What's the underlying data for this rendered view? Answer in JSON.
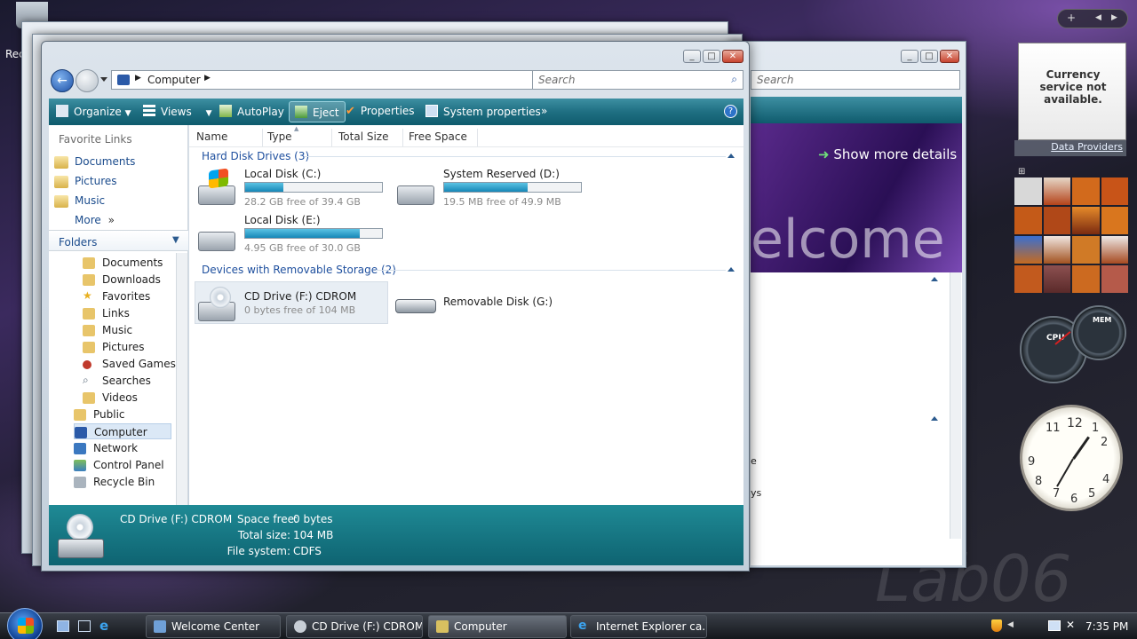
{
  "desktop": {
    "recycle_label": "Rec",
    "watermark": "Lab06"
  },
  "main_window": {
    "address": {
      "root": "Computer"
    },
    "search_placeholder": "Search",
    "toolbar": {
      "organize": "Organize",
      "views": "Views",
      "autoplay": "AutoPlay",
      "eject": "Eject",
      "properties": "Properties",
      "system_properties": "System properties",
      "more": "»"
    },
    "favorites": {
      "title": "Favorite Links",
      "items": [
        "Documents",
        "Pictures",
        "Music"
      ],
      "more": "More"
    },
    "folders": {
      "title": "Folders",
      "items": [
        "Documents",
        "Downloads",
        "Favorites",
        "Links",
        "Music",
        "Pictures",
        "Saved Games",
        "Searches",
        "Videos",
        "Public",
        "Computer",
        "Network",
        "Control Panel",
        "Recycle Bin"
      ]
    },
    "columns": [
      "Name",
      "Type",
      "Total Size",
      "Free Space"
    ],
    "groups": {
      "hdd_title": "Hard Disk Drives (3)",
      "removable_title": "Devices with Removable Storage (2)"
    },
    "drives": {
      "c": {
        "name": "Local Disk (C:)",
        "free": "28.2 GB free of 39.4 GB",
        "used_fraction": 0.28
      },
      "d": {
        "name": "System Reserved (D:)",
        "free": "19.5 MB free of 49.9 MB",
        "used_fraction": 0.61
      },
      "e": {
        "name": "Local Disk (E:)",
        "free": "4.95 GB free of 30.0 GB",
        "used_fraction": 0.84
      },
      "f": {
        "name": "CD Drive (F:) CDROM",
        "free": "0 bytes free of 104 MB"
      },
      "g": {
        "name": "Removable Disk (G:)"
      }
    },
    "status": {
      "name": "CD Drive (F:) CDROM",
      "space_free_label": "Space free:",
      "space_free": "0 bytes",
      "total_size_label": "Total size:",
      "total_size": "104 MB",
      "file_system_label": "File system:",
      "file_system": "CDFS"
    }
  },
  "welcome_window": {
    "search_placeholder": "Search",
    "show_more": "Show more details",
    "banner_text": "elcome",
    "side_text_1": "e",
    "side_text_2": "ys"
  },
  "sidebar": {
    "currency": "Currency service not available.",
    "data_providers": "Data Providers",
    "cpu": "CPU",
    "mem": "MEM",
    "clock": {
      "n12": "12",
      "n1": "1",
      "n2": "2",
      "n4": "4",
      "n5": "5",
      "n6": "6",
      "n7": "7",
      "n8": "8",
      "n9": "9",
      "n11": "11"
    }
  },
  "taskbar": {
    "buttons": [
      "Welcome Center",
      "CD Drive (F:) CDROM",
      "Computer",
      "Internet Explorer ca..."
    ],
    "time": "7:35 PM"
  }
}
